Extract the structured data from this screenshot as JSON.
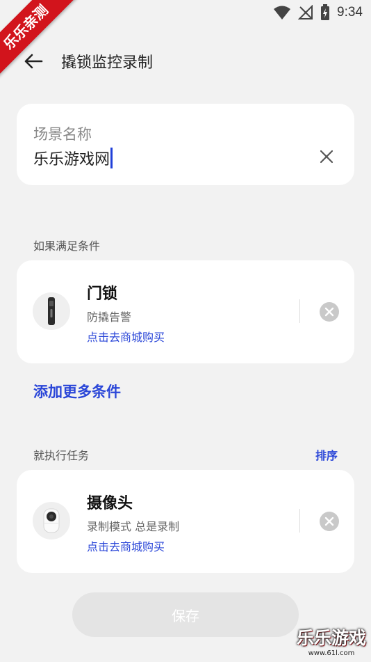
{
  "status_bar": {
    "time": "9:34"
  },
  "corner_badge": "乐乐亲测",
  "header": {
    "title": "撬锁监控录制"
  },
  "scene_name": {
    "label": "场景名称",
    "value": "乐乐游戏网"
  },
  "conditions": {
    "section_label": "如果满足条件",
    "device": {
      "name": "门锁",
      "description": "防撬告警",
      "shop_link": "点击去商城购买"
    },
    "add_more": "添加更多条件"
  },
  "tasks": {
    "section_label": "就执行任务",
    "sort_label": "排序",
    "device": {
      "name": "摄像头",
      "description": "录制模式 总是录制",
      "shop_link": "点击去商城购买"
    }
  },
  "save_button": "保存",
  "watermark": {
    "text": "乐乐游戏",
    "url": "www.61l.com"
  },
  "colors": {
    "accent": "#2a46d8",
    "background": "#f2f2f2",
    "card": "#ffffff",
    "badge": "#d2141c"
  }
}
